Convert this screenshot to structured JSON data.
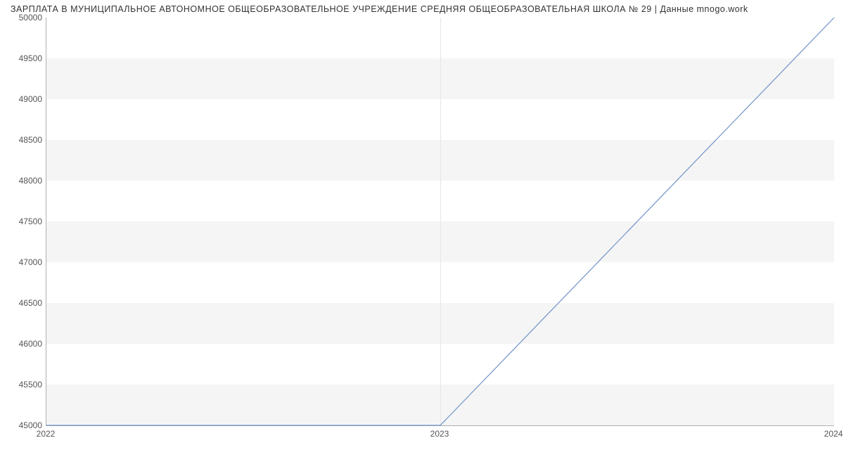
{
  "chart_data": {
    "type": "line",
    "title": "ЗАРПЛАТА В МУНИЦИПАЛЬНОЕ АВТОНОМНОЕ ОБЩЕОБРАЗОВАТЕЛЬНОЕ УЧРЕЖДЕНИЕ СРЕДНЯЯ ОБЩЕОБРАЗОВАТЕЛЬНАЯ ШКОЛА № 29 | Данные mnogo.work",
    "x": [
      2022,
      2023,
      2024
    ],
    "values": [
      45000,
      45000,
      50000
    ],
    "x_ticks": [
      2022,
      2023,
      2024
    ],
    "y_ticks": [
      45000,
      45500,
      46000,
      46500,
      47000,
      47500,
      48000,
      48500,
      49000,
      49500,
      50000
    ],
    "xlim": [
      2022,
      2024
    ],
    "ylim": [
      45000,
      50000
    ],
    "line_color": "#6f94c8",
    "band_color": "#f5f5f5"
  }
}
